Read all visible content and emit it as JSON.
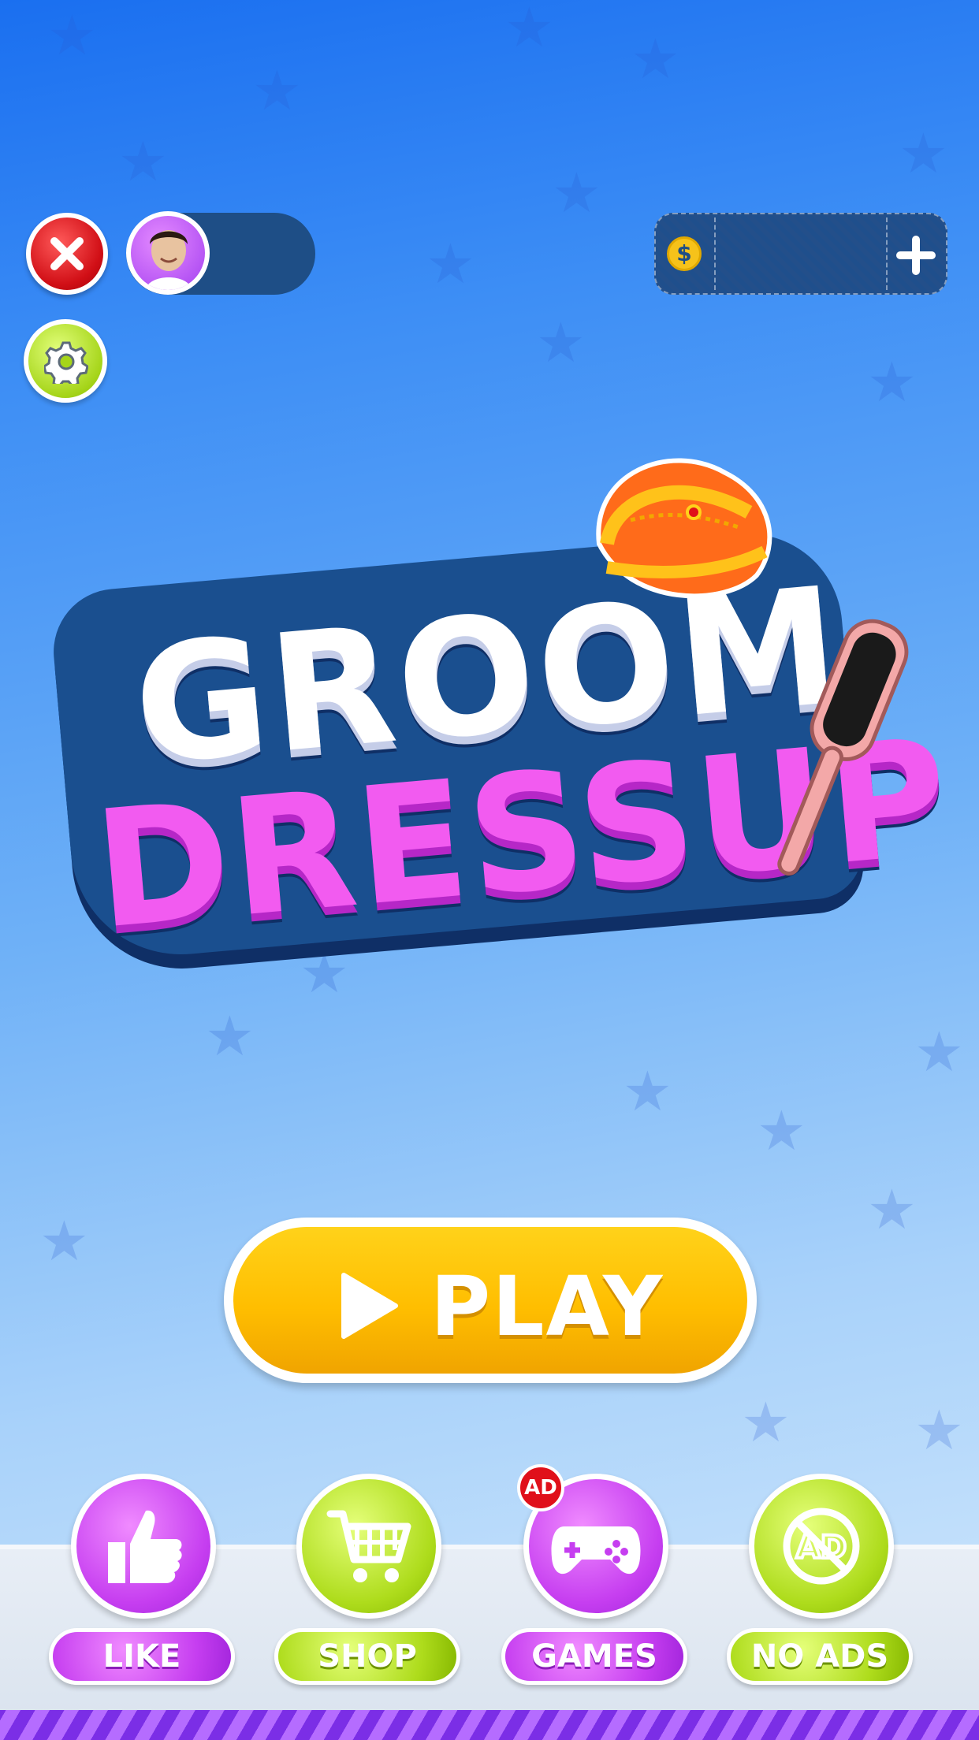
{
  "game": {
    "title_line1": "GROOM",
    "title_line2": "DRESSUP"
  },
  "top_bar": {
    "close_icon": "close-icon",
    "avatar_icon": "player-avatar",
    "settings_icon": "gear-icon",
    "coins": {
      "icon": "dollar-coin-icon",
      "symbol": "$",
      "value": "",
      "add_icon": "plus-icon"
    }
  },
  "play_button": {
    "label": "PLAY",
    "icon": "play-icon"
  },
  "menu": [
    {
      "label": "LIKE",
      "icon": "thumbs-up-icon",
      "color": "#c63ef0"
    },
    {
      "label": "SHOP",
      "icon": "cart-icon",
      "color": "#aedc1c"
    },
    {
      "label": "GAMES",
      "icon": "gamepad-icon",
      "color": "#c63ef0",
      "badge": "AD"
    },
    {
      "label": "NO ADS",
      "icon": "no-ads-icon",
      "color": "#aedc1c"
    }
  ],
  "colors": {
    "accent_yellow": "#ffbe00",
    "purple": "#c63ef0",
    "green": "#aedc1c",
    "navy": "#1e4e86"
  }
}
